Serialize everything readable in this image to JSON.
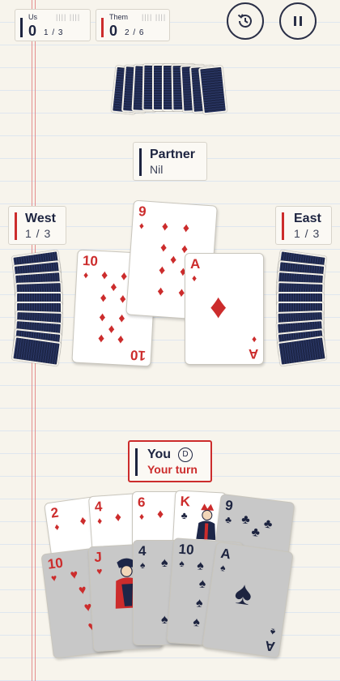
{
  "scoreboard": {
    "us": {
      "label": "Us",
      "score": "0",
      "tricks": "1 / 3",
      "tally": "||||  ||||",
      "color": "#1d2440"
    },
    "them": {
      "label": "Them",
      "score": "0",
      "tricks": "2 / 6",
      "tally": "||||  ||||",
      "color": "#cc2c2c"
    }
  },
  "controls": {
    "history_icon": "history-icon",
    "pause_icon": "pause-icon"
  },
  "players": {
    "partner": {
      "name": "Partner",
      "bid": "Nil",
      "bar_color": "#1d2440"
    },
    "west": {
      "name": "West",
      "tricks": "1 / 3",
      "bar_color": "#cc2c2c"
    },
    "east": {
      "name": "East",
      "tricks": "1 / 3",
      "bar_color": "#cc2c2c"
    },
    "you": {
      "name": "You",
      "dealer_badge": "D",
      "status": "Your turn",
      "bar_color": "#1d2440",
      "status_color": "#cc2c2c"
    }
  },
  "trick": [
    {
      "rank": "10",
      "suit": "♦",
      "color": "red",
      "player": "west"
    },
    {
      "rank": "9",
      "suit": "♦",
      "color": "red",
      "player": "partner"
    },
    {
      "rank": "A",
      "suit": "♦",
      "color": "red",
      "player": "east"
    }
  ],
  "hand": {
    "back_row": [
      {
        "rank": "2",
        "suit": "♦",
        "color": "red"
      },
      {
        "rank": "4",
        "suit": "♦",
        "color": "red"
      },
      {
        "rank": "6",
        "suit": "♦",
        "color": "red"
      },
      {
        "rank": "K",
        "suit": "♣",
        "color": "red"
      },
      {
        "rank": "9",
        "suit": "♣",
        "color": "blk"
      }
    ],
    "front_row": [
      {
        "rank": "10",
        "suit": "♥",
        "color": "red"
      },
      {
        "rank": "J",
        "suit": "♥",
        "color": "red"
      },
      {
        "rank": "4",
        "suit": "♠",
        "color": "blk"
      },
      {
        "rank": "10",
        "suit": "♠",
        "color": "blk"
      },
      {
        "rank": "A",
        "suit": "♠",
        "color": "blk"
      }
    ]
  },
  "opponent_card_counts": {
    "partner": 10,
    "west": 10,
    "east": 10
  }
}
